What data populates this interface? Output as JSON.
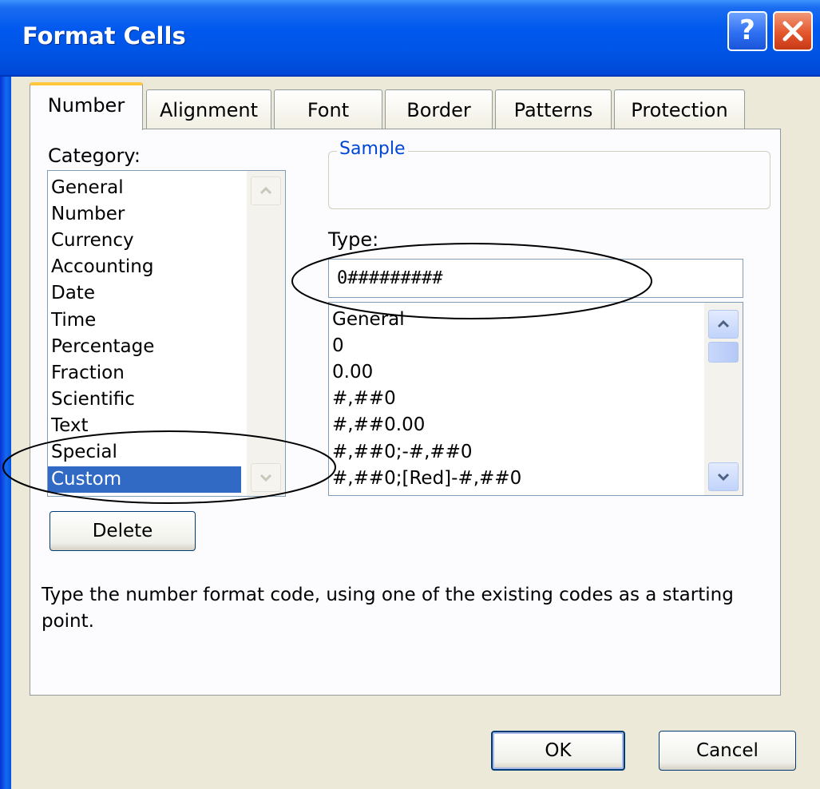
{
  "window": {
    "title": "Format Cells"
  },
  "title_buttons": {
    "help": "?"
  },
  "tabs": [
    {
      "label": "Number"
    },
    {
      "label": "Alignment"
    },
    {
      "label": "Font"
    },
    {
      "label": "Border"
    },
    {
      "label": "Patterns"
    },
    {
      "label": "Protection"
    }
  ],
  "category": {
    "label": "Category:",
    "items": [
      "General",
      "Number",
      "Currency",
      "Accounting",
      "Date",
      "Time",
      "Percentage",
      "Fraction",
      "Scientific",
      "Text",
      "Special",
      "Custom"
    ],
    "selected": "Custom"
  },
  "sample": {
    "legend": "Sample",
    "value": ""
  },
  "type": {
    "label": "Type:",
    "value": "0#########",
    "options": [
      "General",
      "0",
      "0.00",
      "#,##0",
      "#,##0.00",
      "#,##0;-#,##0",
      "#,##0;[Red]-#,##0"
    ]
  },
  "delete_button": "Delete",
  "description": "Type the number format code, using one of the existing codes as a starting point.",
  "ok_button": "OK",
  "cancel_button": "Cancel"
}
